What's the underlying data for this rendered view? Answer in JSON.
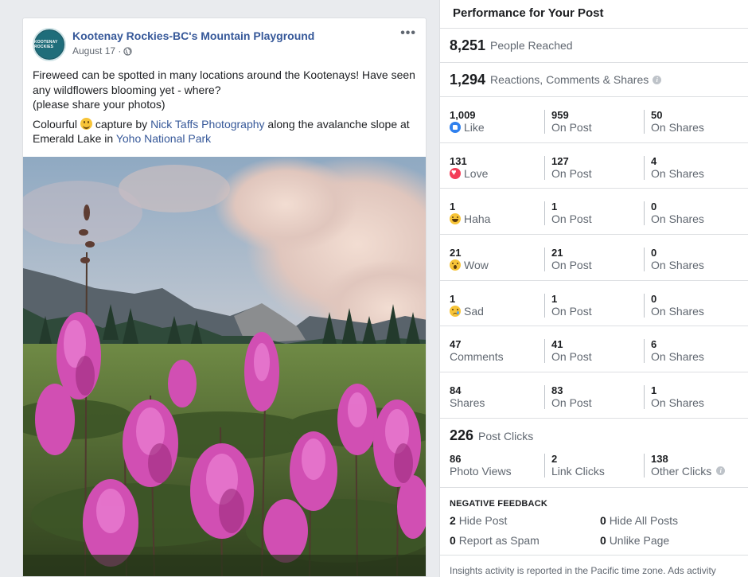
{
  "post": {
    "page_name": "Kootenay Rockies-BC's Mountain Playground",
    "avatar_text": "KOOTENAY ROCKIES",
    "date": "August 17 ·",
    "more_label": "•••",
    "text_line1": "Fireweed can be spotted in many locations around the Kootenays! Have seen any wildflowers blooming yet - where?",
    "text_line2": "(please share your photos)",
    "caption_pre": "Colourful",
    "caption_mid": "capture by",
    "caption_link1": "Nick Taffs Photography",
    "caption_mid2": "along the avalanche slope at Emerald Lake in",
    "caption_link2": "Yoho National Park"
  },
  "insights": {
    "title": "Performance for Your Post",
    "reached": {
      "value": "8,251",
      "label": "People Reached"
    },
    "engagement": {
      "value": "1,294",
      "label": "Reactions, Comments & Shares"
    },
    "rows": [
      {
        "total": "1,009",
        "label": "Like",
        "icon": "like-icon",
        "on_post": "959",
        "on_post_label": "On Post",
        "on_shares": "50",
        "on_shares_label": "On Shares"
      },
      {
        "total": "131",
        "label": "Love",
        "icon": "love-icon",
        "on_post": "127",
        "on_post_label": "On Post",
        "on_shares": "4",
        "on_shares_label": "On Shares"
      },
      {
        "total": "1",
        "label": "Haha",
        "icon": "haha-icon",
        "on_post": "1",
        "on_post_label": "On Post",
        "on_shares": "0",
        "on_shares_label": "On Shares"
      },
      {
        "total": "21",
        "label": "Wow",
        "icon": "wow-icon",
        "on_post": "21",
        "on_post_label": "On Post",
        "on_shares": "0",
        "on_shares_label": "On Shares"
      },
      {
        "total": "1",
        "label": "Sad",
        "icon": "sad-icon",
        "on_post": "1",
        "on_post_label": "On Post",
        "on_shares": "0",
        "on_shares_label": "On Shares"
      },
      {
        "total": "47",
        "label": "Comments",
        "on_post": "41",
        "on_post_label": "On Post",
        "on_shares": "6",
        "on_shares_label": "On Shares"
      },
      {
        "total": "84",
        "label": "Shares",
        "on_post": "83",
        "on_post_label": "On Post",
        "on_shares": "1",
        "on_shares_label": "On Shares"
      }
    ],
    "clicks": {
      "value": "226",
      "label": "Post Clicks",
      "photo_views": "86",
      "photo_views_label": "Photo Views",
      "link_clicks": "2",
      "link_clicks_label": "Link Clicks",
      "other_clicks": "138",
      "other_clicks_label": "Other Clicks"
    },
    "negative": {
      "title": "NEGATIVE FEEDBACK",
      "hide_post": "2",
      "hide_post_label": "Hide Post",
      "hide_all": "0",
      "hide_all_label": "Hide All Posts",
      "spam": "0",
      "spam_label": "Report as Spam",
      "unlike": "0",
      "unlike_label": "Unlike Page"
    },
    "footer": "Insights activity is reported in the Pacific time zone. Ads activity"
  },
  "colors": {
    "link": "#365899",
    "muted": "#606770",
    "like": "#2f80ed",
    "love": "#f33e58",
    "face": "#f7c438"
  }
}
